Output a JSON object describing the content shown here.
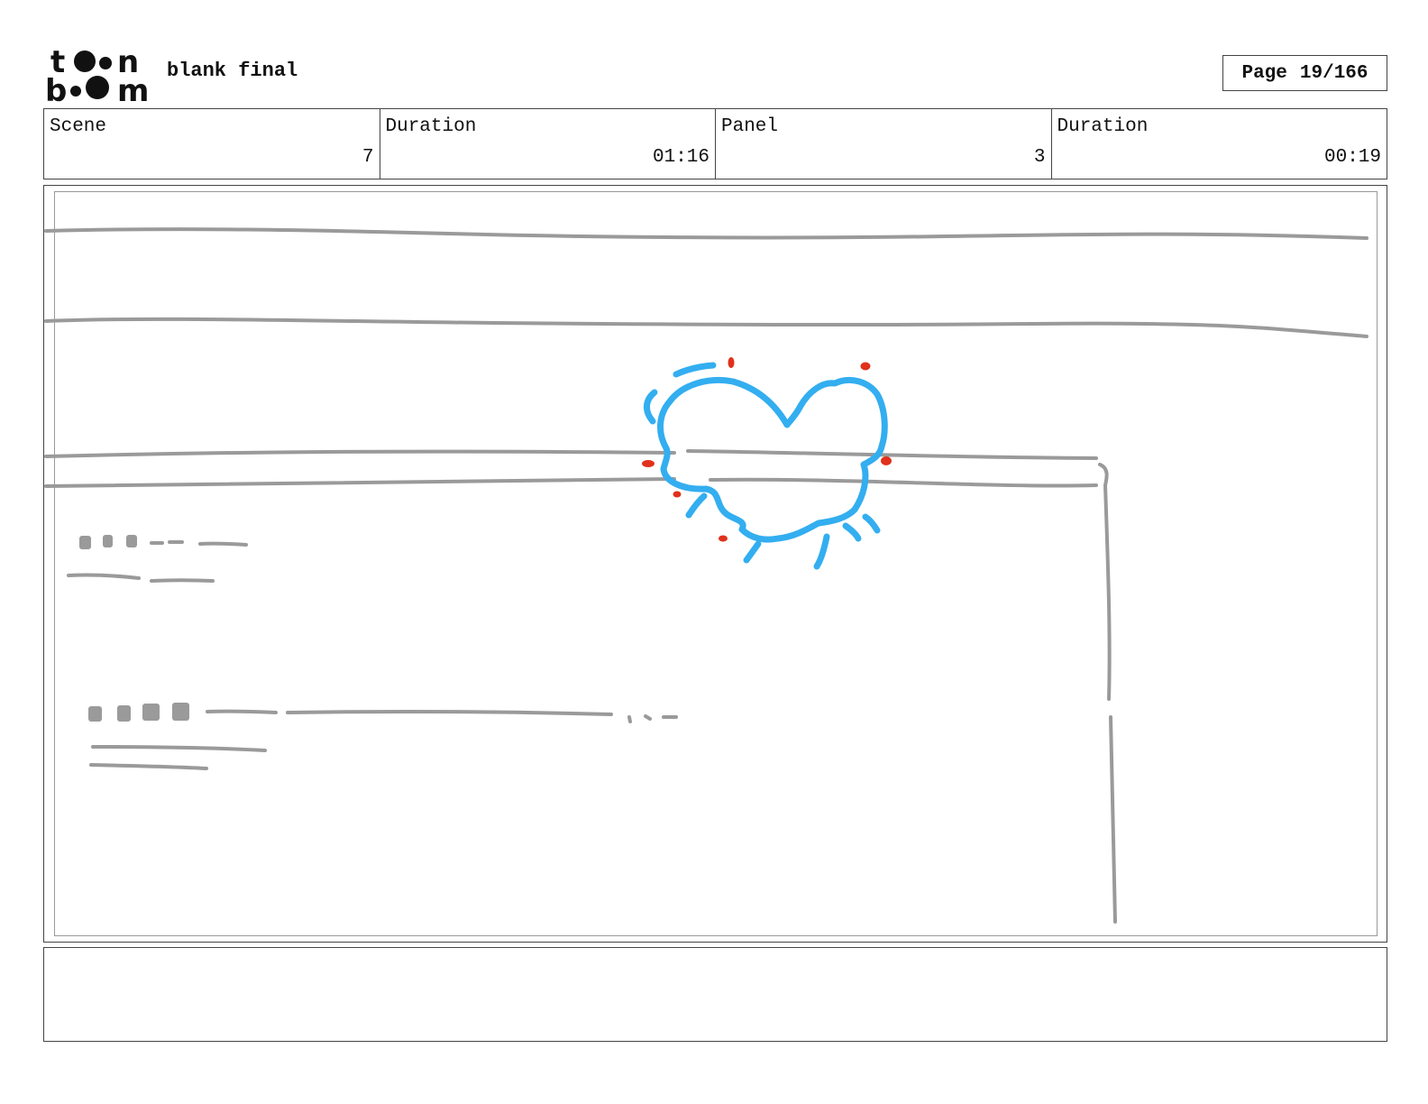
{
  "header": {
    "logo_text": "toon boom",
    "title": "blank final",
    "page_label": "Page",
    "page_number": "19/166"
  },
  "info": {
    "scene_label": "Scene",
    "scene_value": "7",
    "scene_duration_label": "Duration",
    "scene_duration_value": "01:16",
    "panel_label": "Panel",
    "panel_value": "3",
    "panel_duration_label": "Duration",
    "panel_duration_value": "00:19"
  },
  "colors": {
    "sketch_gray": "#9a9a9a",
    "impact_blue": "#33aef0",
    "impact_red": "#e0311c"
  },
  "notes": ""
}
